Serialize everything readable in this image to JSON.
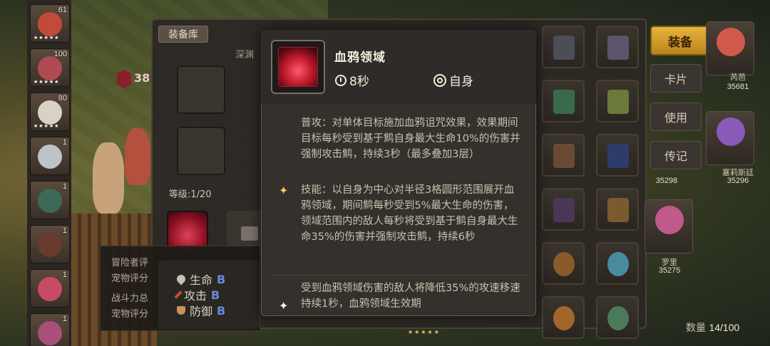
{
  "left_heroes": [
    {
      "level": "61"
    },
    {
      "level": "100"
    },
    {
      "level": "80"
    },
    {
      "level": "1"
    },
    {
      "level": "1"
    },
    {
      "level": "1"
    },
    {
      "level": "1"
    },
    {
      "level": "1"
    }
  ],
  "equip_panel": {
    "tab_label": "装备库",
    "deep_label": "深渊",
    "pet_level": "38",
    "level_text": "等级:1/20",
    "info_lines": [
      "冒险者评",
      "宠物评分",
      "战斗力总",
      "宠物评分"
    ],
    "stats": [
      {
        "name": "生命",
        "grade": "B"
      },
      {
        "name": "攻击",
        "grade": "B"
      },
      {
        "name": "防御",
        "grade": "B"
      }
    ]
  },
  "right_panel": {
    "equip_button": "装备",
    "side_buttons": [
      "卡片",
      "使用",
      "传记"
    ],
    "heroes": [
      {
        "name": "芮芭",
        "power": "35681"
      },
      {
        "name": "塞莉斯廷",
        "power": "35296"
      },
      {
        "name": "",
        "power": "35298"
      },
      {
        "name": "罗里",
        "power": "35275"
      }
    ],
    "count_label": "数量",
    "count_value": "14/100"
  },
  "skill_popup": {
    "name": "血鸦领域",
    "cooldown": "8秒",
    "target": "自身",
    "normal_attack": "普攻：对单体目标施加血鸦诅咒效果，效果期间目标每秒受到基于鹪自身最大生命10%的伤害并强制攻击鹪，持续3秒（最多叠加3层）",
    "skill": "技能：以自身为中心对半径3格圆形范围展开血鸦领域，期间鹪每秒受到5%最大生命的伤害，领域范围内的敌人每秒将受到基于鹪自身最大生命35%的伤害并强制攻击鹪，持续6秒",
    "passive": "受到血鸦领域伤害的敌人将降低35%的攻速移速持续1秒，血鸦领域生效期"
  }
}
